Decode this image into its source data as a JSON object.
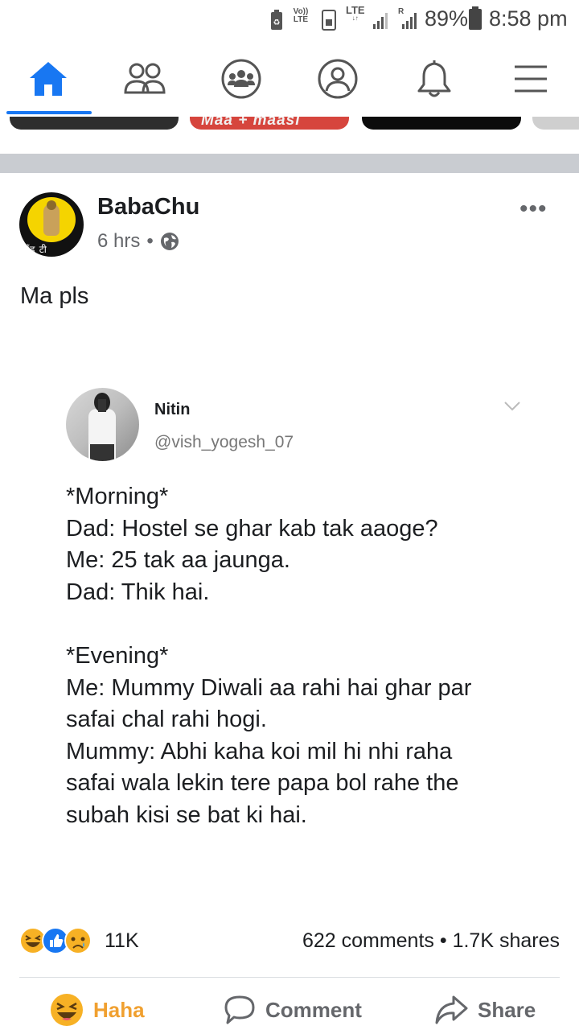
{
  "status_bar": {
    "volte": "Vo))",
    "lte_small": "LTE",
    "lte": "LTE",
    "roaming": "R",
    "battery": "89%",
    "time": "8:58 pm"
  },
  "nav": {
    "items": [
      {
        "name": "home",
        "active": true
      },
      {
        "name": "friends",
        "active": false
      },
      {
        "name": "groups",
        "active": false
      },
      {
        "name": "profile",
        "active": false
      },
      {
        "name": "notifications",
        "active": false
      },
      {
        "name": "menu",
        "active": false
      }
    ],
    "accent": "#1877f2"
  },
  "stories": {
    "partial_label": "Maa + maasi"
  },
  "post": {
    "author": "BabaChu",
    "time": "6 hrs",
    "privacy_icon": "globe-icon",
    "text": "Ma pls",
    "avatar_signature": "बाँड टी"
  },
  "tweet": {
    "name": "Nitin",
    "handle": "@vish_yogesh_07",
    "lines": [
      "*Morning*",
      "Dad: Hostel se ghar kab tak aaoge?",
      "Me: 25 tak aa jaunga.",
      "Dad: Thik hai.",
      "",
      "*Evening*",
      "Me: Mummy Diwali aa rahi hai ghar par",
      "safai chal rahi hogi.",
      "Mummy: Abhi kaha koi mil hi nhi raha",
      "safai wala lekin tere papa bol rahe the",
      "subah kisi se bat ki hai."
    ]
  },
  "engagement": {
    "reaction_count": "11K",
    "comments": "622 comments",
    "separator": "•",
    "shares": "1.7K shares"
  },
  "actions": {
    "reaction": "Haha",
    "comment": "Comment",
    "share": "Share"
  }
}
